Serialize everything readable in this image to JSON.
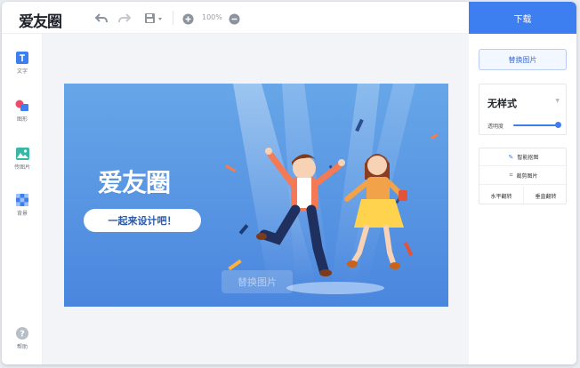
{
  "app": {
    "logo_text": "爱友圈"
  },
  "toolbar": {
    "zoom_value": "100%",
    "download_label": "下载"
  },
  "sidebar": {
    "items": [
      {
        "label": "文字"
      },
      {
        "label": "图形"
      },
      {
        "label": "传图片"
      },
      {
        "label": "背景"
      }
    ],
    "help_label": "帮助"
  },
  "canvas": {
    "brand_text": "爱友圈",
    "slogan": "一起来设计吧！",
    "replace_overlay_label": "替换图片"
  },
  "panel": {
    "replace_button_label": "替换图片",
    "style_value": "无样式",
    "opacity_label": "透明度",
    "opacity": 1.0,
    "smart_cutout_label": "智能抠图",
    "crop_label": "裁剪图片",
    "flip_horizontal_label": "水平翻转",
    "flip_vertical_label": "垂直翻转"
  },
  "colors": {
    "accent": "#3d7ef0",
    "canvas_bg": "#5b9bea"
  }
}
